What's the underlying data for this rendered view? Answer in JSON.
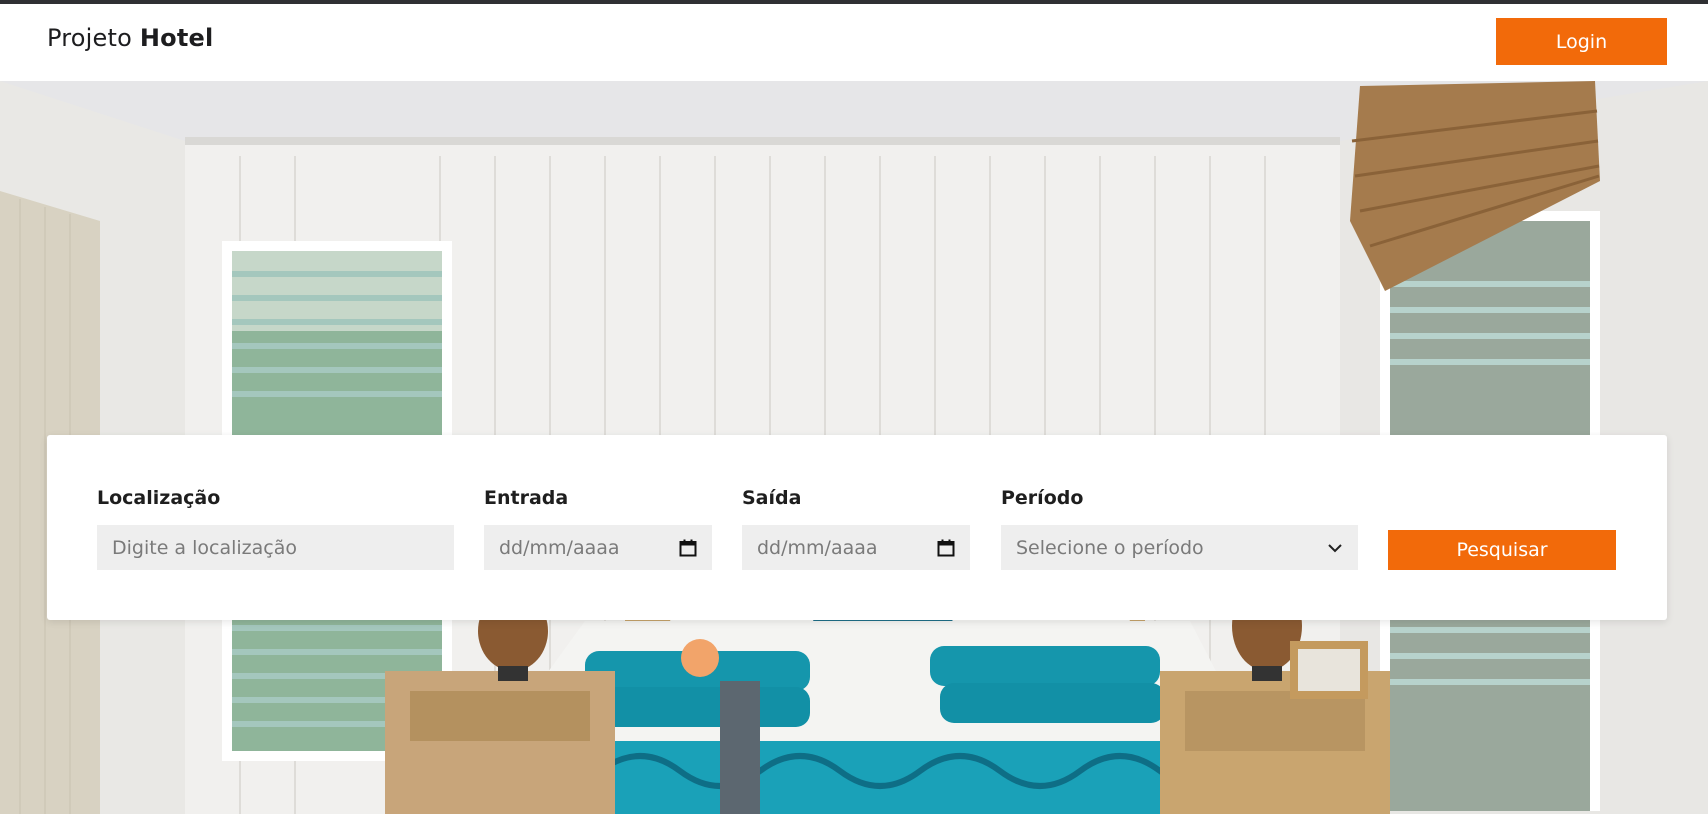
{
  "header": {
    "brand_prefix": "Projeto ",
    "brand_bold": "Hotel",
    "login_label": "Login"
  },
  "search": {
    "location_label": "Localização",
    "location_placeholder": "Digite a localização",
    "checkin_label": "Entrada",
    "checkin_placeholder": "dd/mm/aaaa",
    "checkout_label": "Saída",
    "checkout_placeholder": "dd/mm/aaaa",
    "period_label": "Período",
    "period_selected": "Selecione o período",
    "submit_label": "Pesquisar"
  },
  "icons": {
    "calendar": "calendar-icon",
    "dropdown": "chevron-down-icon"
  },
  "colors": {
    "accent": "#f26a0a",
    "topbar": "#2f3033",
    "field_bg": "#eeeeee"
  }
}
